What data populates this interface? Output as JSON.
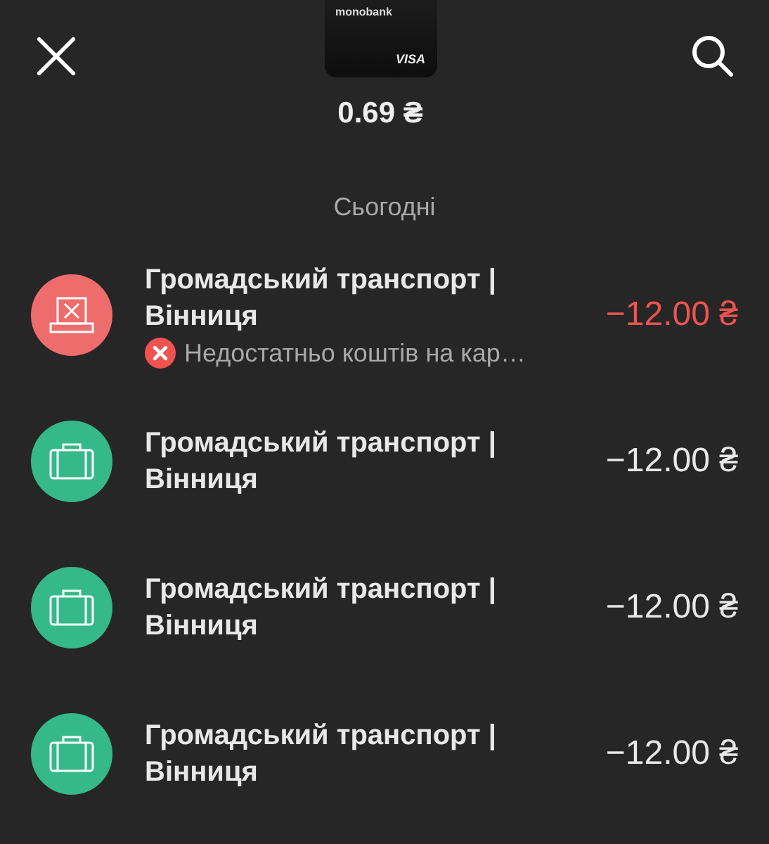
{
  "card": {
    "bank": "monobank",
    "network": "VISA"
  },
  "balance": "0.69 ₴",
  "section": "Сьогодні",
  "transactions": [
    {
      "kind": "declined",
      "title": "Громадський транспорт | Вінниця",
      "amount": "−12.00 ₴",
      "note": "Недостатньо коштів на кар…"
    },
    {
      "kind": "ok",
      "title": "Громадський транспорт | Вінниця",
      "amount": "−12.00 ₴"
    },
    {
      "kind": "ok",
      "title": "Громадський транспорт | Вінниця",
      "amount": "−12.00 ₴"
    },
    {
      "kind": "ok",
      "title": "Громадський транспорт | Вінниця",
      "amount": "−12.00 ₴"
    }
  ]
}
